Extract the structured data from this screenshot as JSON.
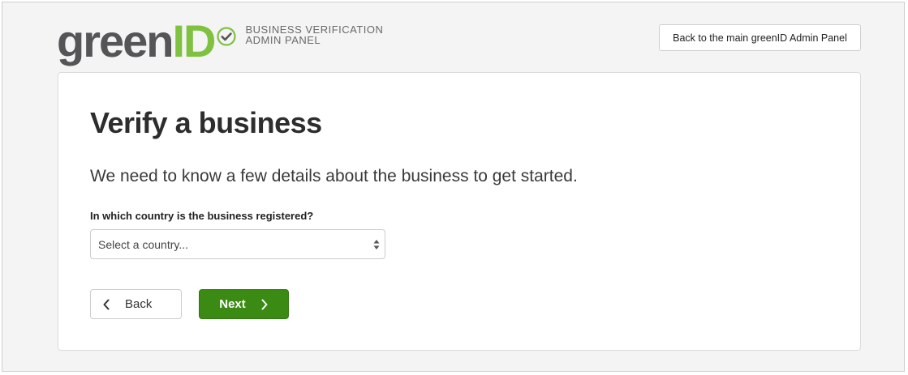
{
  "header": {
    "logo": {
      "word_main": "green",
      "word_accent": "ID",
      "subtitle_line1": "BUSINESS VERIFICATION",
      "subtitle_line2": "ADMIN PANEL",
      "check_icon": "check-circle-icon"
    },
    "admin_button_label": "Back to the main greenID Admin Panel"
  },
  "card": {
    "title": "Verify a business",
    "lead": "We need to know a few details about the business to get started.",
    "country_label": "In which country is the business registered?",
    "country_select": {
      "value": "Select a country...",
      "arrow_icon": "up-down-arrows-icon"
    },
    "back_button": {
      "label": "Back",
      "icon": "chevron-left-icon"
    },
    "next_button": {
      "label": "Next",
      "icon": "chevron-right-icon"
    }
  },
  "colors": {
    "brand_green": "#7fc241",
    "logo_grey": "#555557",
    "next_button": "#3a8a14",
    "page_bg": "#f4f4f4"
  }
}
